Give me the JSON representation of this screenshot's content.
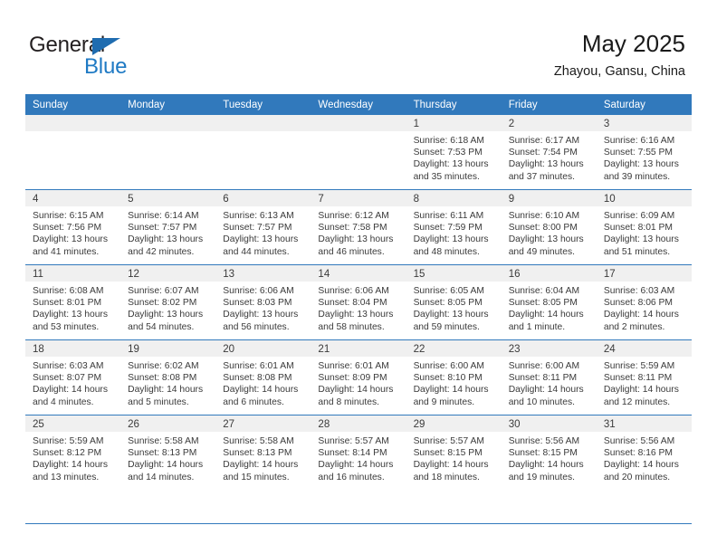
{
  "brand": {
    "name_top": "General",
    "name_bottom": "Blue",
    "triangle_color": "#1f6cb0",
    "blue_text_color": "#1f7ac4"
  },
  "header": {
    "title": "May 2025",
    "subtitle": "Zhayou, Gansu, China"
  },
  "theme": {
    "header_blue": "#3179bc",
    "daynum_bg": "#f0f0f0",
    "text_color": "#3a3a3a"
  },
  "weekday_headers": [
    "Sunday",
    "Monday",
    "Tuesday",
    "Wednesday",
    "Thursday",
    "Friday",
    "Saturday"
  ],
  "weeks": [
    [
      {
        "day": "",
        "empty": true
      },
      {
        "day": "",
        "empty": true
      },
      {
        "day": "",
        "empty": true
      },
      {
        "day": "",
        "empty": true
      },
      {
        "day": "1",
        "sunrise": "Sunrise: 6:18 AM",
        "sunset": "Sunset: 7:53 PM",
        "daylight": "Daylight: 13 hours and 35 minutes."
      },
      {
        "day": "2",
        "sunrise": "Sunrise: 6:17 AM",
        "sunset": "Sunset: 7:54 PM",
        "daylight": "Daylight: 13 hours and 37 minutes."
      },
      {
        "day": "3",
        "sunrise": "Sunrise: 6:16 AM",
        "sunset": "Sunset: 7:55 PM",
        "daylight": "Daylight: 13 hours and 39 minutes."
      }
    ],
    [
      {
        "day": "4",
        "sunrise": "Sunrise: 6:15 AM",
        "sunset": "Sunset: 7:56 PM",
        "daylight": "Daylight: 13 hours and 41 minutes."
      },
      {
        "day": "5",
        "sunrise": "Sunrise: 6:14 AM",
        "sunset": "Sunset: 7:57 PM",
        "daylight": "Daylight: 13 hours and 42 minutes."
      },
      {
        "day": "6",
        "sunrise": "Sunrise: 6:13 AM",
        "sunset": "Sunset: 7:57 PM",
        "daylight": "Daylight: 13 hours and 44 minutes."
      },
      {
        "day": "7",
        "sunrise": "Sunrise: 6:12 AM",
        "sunset": "Sunset: 7:58 PM",
        "daylight": "Daylight: 13 hours and 46 minutes."
      },
      {
        "day": "8",
        "sunrise": "Sunrise: 6:11 AM",
        "sunset": "Sunset: 7:59 PM",
        "daylight": "Daylight: 13 hours and 48 minutes."
      },
      {
        "day": "9",
        "sunrise": "Sunrise: 6:10 AM",
        "sunset": "Sunset: 8:00 PM",
        "daylight": "Daylight: 13 hours and 49 minutes."
      },
      {
        "day": "10",
        "sunrise": "Sunrise: 6:09 AM",
        "sunset": "Sunset: 8:01 PM",
        "daylight": "Daylight: 13 hours and 51 minutes."
      }
    ],
    [
      {
        "day": "11",
        "sunrise": "Sunrise: 6:08 AM",
        "sunset": "Sunset: 8:01 PM",
        "daylight": "Daylight: 13 hours and 53 minutes."
      },
      {
        "day": "12",
        "sunrise": "Sunrise: 6:07 AM",
        "sunset": "Sunset: 8:02 PM",
        "daylight": "Daylight: 13 hours and 54 minutes."
      },
      {
        "day": "13",
        "sunrise": "Sunrise: 6:06 AM",
        "sunset": "Sunset: 8:03 PM",
        "daylight": "Daylight: 13 hours and 56 minutes."
      },
      {
        "day": "14",
        "sunrise": "Sunrise: 6:06 AM",
        "sunset": "Sunset: 8:04 PM",
        "daylight": "Daylight: 13 hours and 58 minutes."
      },
      {
        "day": "15",
        "sunrise": "Sunrise: 6:05 AM",
        "sunset": "Sunset: 8:05 PM",
        "daylight": "Daylight: 13 hours and 59 minutes."
      },
      {
        "day": "16",
        "sunrise": "Sunrise: 6:04 AM",
        "sunset": "Sunset: 8:05 PM",
        "daylight": "Daylight: 14 hours and 1 minute."
      },
      {
        "day": "17",
        "sunrise": "Sunrise: 6:03 AM",
        "sunset": "Sunset: 8:06 PM",
        "daylight": "Daylight: 14 hours and 2 minutes."
      }
    ],
    [
      {
        "day": "18",
        "sunrise": "Sunrise: 6:03 AM",
        "sunset": "Sunset: 8:07 PM",
        "daylight": "Daylight: 14 hours and 4 minutes."
      },
      {
        "day": "19",
        "sunrise": "Sunrise: 6:02 AM",
        "sunset": "Sunset: 8:08 PM",
        "daylight": "Daylight: 14 hours and 5 minutes."
      },
      {
        "day": "20",
        "sunrise": "Sunrise: 6:01 AM",
        "sunset": "Sunset: 8:08 PM",
        "daylight": "Daylight: 14 hours and 6 minutes."
      },
      {
        "day": "21",
        "sunrise": "Sunrise: 6:01 AM",
        "sunset": "Sunset: 8:09 PM",
        "daylight": "Daylight: 14 hours and 8 minutes."
      },
      {
        "day": "22",
        "sunrise": "Sunrise: 6:00 AM",
        "sunset": "Sunset: 8:10 PM",
        "daylight": "Daylight: 14 hours and 9 minutes."
      },
      {
        "day": "23",
        "sunrise": "Sunrise: 6:00 AM",
        "sunset": "Sunset: 8:11 PM",
        "daylight": "Daylight: 14 hours and 10 minutes."
      },
      {
        "day": "24",
        "sunrise": "Sunrise: 5:59 AM",
        "sunset": "Sunset: 8:11 PM",
        "daylight": "Daylight: 14 hours and 12 minutes."
      }
    ],
    [
      {
        "day": "25",
        "sunrise": "Sunrise: 5:59 AM",
        "sunset": "Sunset: 8:12 PM",
        "daylight": "Daylight: 14 hours and 13 minutes."
      },
      {
        "day": "26",
        "sunrise": "Sunrise: 5:58 AM",
        "sunset": "Sunset: 8:13 PM",
        "daylight": "Daylight: 14 hours and 14 minutes."
      },
      {
        "day": "27",
        "sunrise": "Sunrise: 5:58 AM",
        "sunset": "Sunset: 8:13 PM",
        "daylight": "Daylight: 14 hours and 15 minutes."
      },
      {
        "day": "28",
        "sunrise": "Sunrise: 5:57 AM",
        "sunset": "Sunset: 8:14 PM",
        "daylight": "Daylight: 14 hours and 16 minutes."
      },
      {
        "day": "29",
        "sunrise": "Sunrise: 5:57 AM",
        "sunset": "Sunset: 8:15 PM",
        "daylight": "Daylight: 14 hours and 18 minutes."
      },
      {
        "day": "30",
        "sunrise": "Sunrise: 5:56 AM",
        "sunset": "Sunset: 8:15 PM",
        "daylight": "Daylight: 14 hours and 19 minutes."
      },
      {
        "day": "31",
        "sunrise": "Sunrise: 5:56 AM",
        "sunset": "Sunset: 8:16 PM",
        "daylight": "Daylight: 14 hours and 20 minutes."
      }
    ]
  ]
}
